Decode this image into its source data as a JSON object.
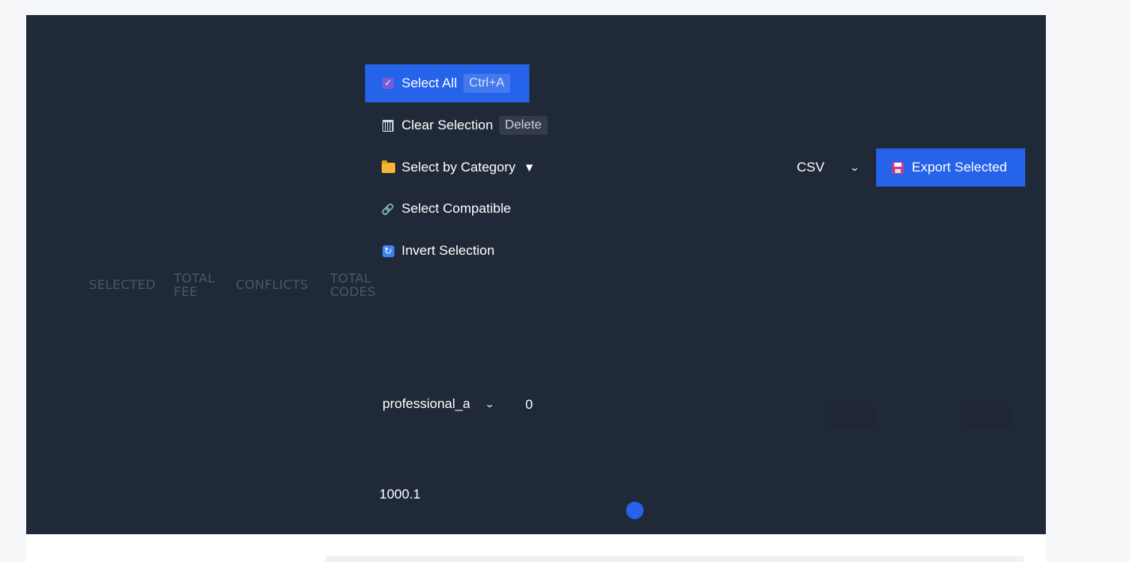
{
  "stats": {
    "selected": "SELECTED",
    "total_fee": "TOTAL FEE",
    "conflicts": "CONFLICTS",
    "total_codes": "TOTAL CODES"
  },
  "menu": {
    "select_all": {
      "label": "Select All",
      "shortcut": "Ctrl+A",
      "icon": "checkbox-icon",
      "active": true
    },
    "clear_selection": {
      "label": "Clear Selection",
      "shortcut": "Delete",
      "icon": "wastebasket-icon"
    },
    "select_by_category": {
      "label": "Select by Category",
      "caret": "▼",
      "icon": "folder-icon"
    },
    "select_compatible": {
      "label": "Select Compatible",
      "icon": "link-icon",
      "glyph": "🔗"
    },
    "invert_selection": {
      "label": "Invert Selection",
      "icon": "refresh-icon",
      "glyph": "🔄"
    }
  },
  "export": {
    "format_value": "CSV",
    "button_label": "Export Selected",
    "icon": "floppy-disk-icon"
  },
  "filter": {
    "category_value": "professional_a",
    "count_value": "0",
    "range_value": "1000.1"
  },
  "colors": {
    "panel_bg": "#202938",
    "accent": "#2563eb",
    "page_bg": "#f6f7f9"
  }
}
